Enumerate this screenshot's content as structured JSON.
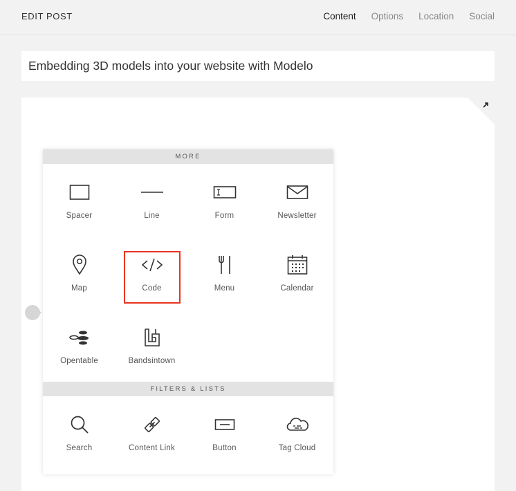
{
  "header": {
    "title": "EDIT POST",
    "tabs": [
      {
        "label": "Content",
        "active": true
      },
      {
        "label": "Options",
        "active": false
      },
      {
        "label": "Location",
        "active": false
      },
      {
        "label": "Social",
        "active": false
      }
    ]
  },
  "post": {
    "title": "Embedding 3D models into your website with Modelo"
  },
  "block_menu": {
    "sections": [
      {
        "heading": "MORE",
        "items": [
          {
            "label": "Spacer",
            "icon": "spacer-icon"
          },
          {
            "label": "Line",
            "icon": "line-icon"
          },
          {
            "label": "Form",
            "icon": "form-icon"
          },
          {
            "label": "Newsletter",
            "icon": "newsletter-icon"
          },
          {
            "label": "Map",
            "icon": "map-pin-icon"
          },
          {
            "label": "Code",
            "icon": "code-icon",
            "highlighted": true
          },
          {
            "label": "Menu",
            "icon": "menu-fork-knife-icon"
          },
          {
            "label": "Calendar",
            "icon": "calendar-icon"
          },
          {
            "label": "Opentable",
            "icon": "opentable-icon"
          },
          {
            "label": "Bandsintown",
            "icon": "bandsintown-icon"
          }
        ]
      },
      {
        "heading": "FILTERS & LISTS",
        "items": [
          {
            "label": "Search",
            "icon": "search-icon"
          },
          {
            "label": "Content Link",
            "icon": "content-link-icon"
          },
          {
            "label": "Button",
            "icon": "button-icon"
          },
          {
            "label": "Tag Cloud",
            "icon": "tag-cloud-icon"
          }
        ]
      }
    ]
  },
  "colors": {
    "highlight": "#e8331f",
    "section_bg": "#e3e3e3",
    "page_bg": "#f2f2f2"
  }
}
